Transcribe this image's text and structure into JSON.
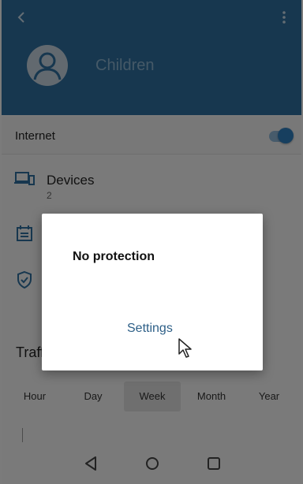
{
  "header": {
    "back_icon": "arrow-back-icon",
    "more_icon": "more-vert-icon",
    "avatar_icon": "person-icon",
    "profile_name": "Children",
    "color": "#2f6f9f"
  },
  "internet": {
    "label": "Internet",
    "enabled": true
  },
  "devices": {
    "icon": "devices-icon",
    "title": "Devices",
    "count": "2"
  },
  "other_icons": [
    "calendar-icon",
    "shield-check-icon"
  ],
  "traffic": {
    "label": "Traffic"
  },
  "period_tabs": [
    {
      "label": "Hour",
      "active": false
    },
    {
      "label": "Day",
      "active": false
    },
    {
      "label": "Week",
      "active": true
    },
    {
      "label": "Month",
      "active": false
    },
    {
      "label": "Year",
      "active": false
    }
  ],
  "dialog": {
    "title": "No protection",
    "action_label": "Settings",
    "action_color": "#2d5f87"
  },
  "navbar": {
    "back": "triangle-back-icon",
    "home": "circle-home-icon",
    "recents": "square-recents-icon"
  }
}
